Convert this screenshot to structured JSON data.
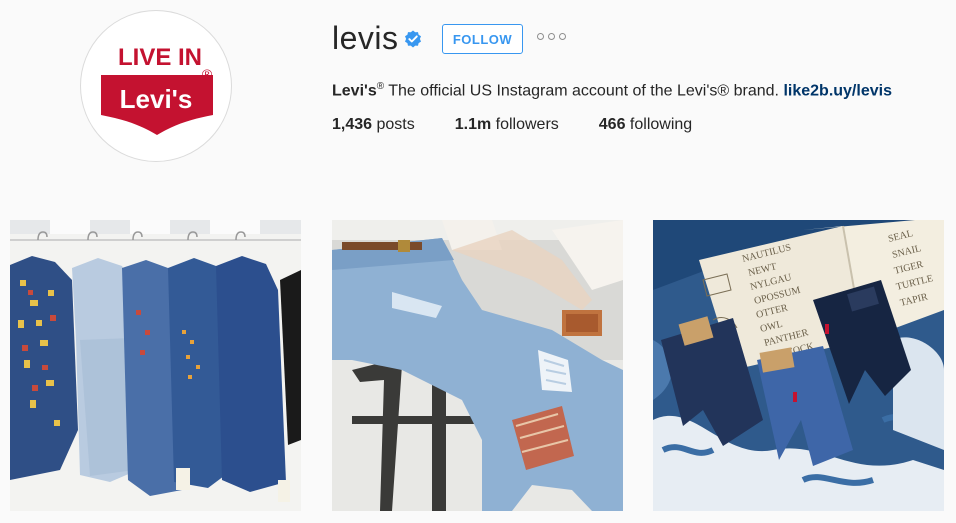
{
  "profile": {
    "logo_line1": "LIVE IN",
    "logo_line2": "Levi's",
    "logo_mark": "®",
    "username": "levis",
    "verified_icon": "verified-badge-icon",
    "follow_label": "FOLLOW",
    "more_icon": "more-options-icon",
    "bio_name": "Levi's",
    "bio_reg": "®",
    "bio_text": " The official US Instagram account of the Levi's® brand. ",
    "bio_link": "like2b.uy/levis"
  },
  "stats": {
    "posts_count": "1,436",
    "posts_label": " posts",
    "followers_count": "1.1m",
    "followers_label": " followers",
    "following_count": "466",
    "following_label": " following"
  },
  "posts": [
    {
      "subject": "denim jackets on rack photo"
    },
    {
      "subject": "ripped jeans on stool photo"
    },
    {
      "subject": "kids jeans with book photo"
    }
  ],
  "colors": {
    "levis_red": "#c41230",
    "follow_blue": "#3897f0",
    "link_blue": "#003569"
  },
  "book_words": [
    "NAUTILUS",
    "NEWT",
    "NYLGAU",
    "OPOSSUM",
    "OTTER",
    "OWL",
    "PANTHER",
    "PEACOCK",
    "SEAL",
    "SNAIL",
    "TIGER",
    "TURTLE",
    "TAPIR"
  ]
}
